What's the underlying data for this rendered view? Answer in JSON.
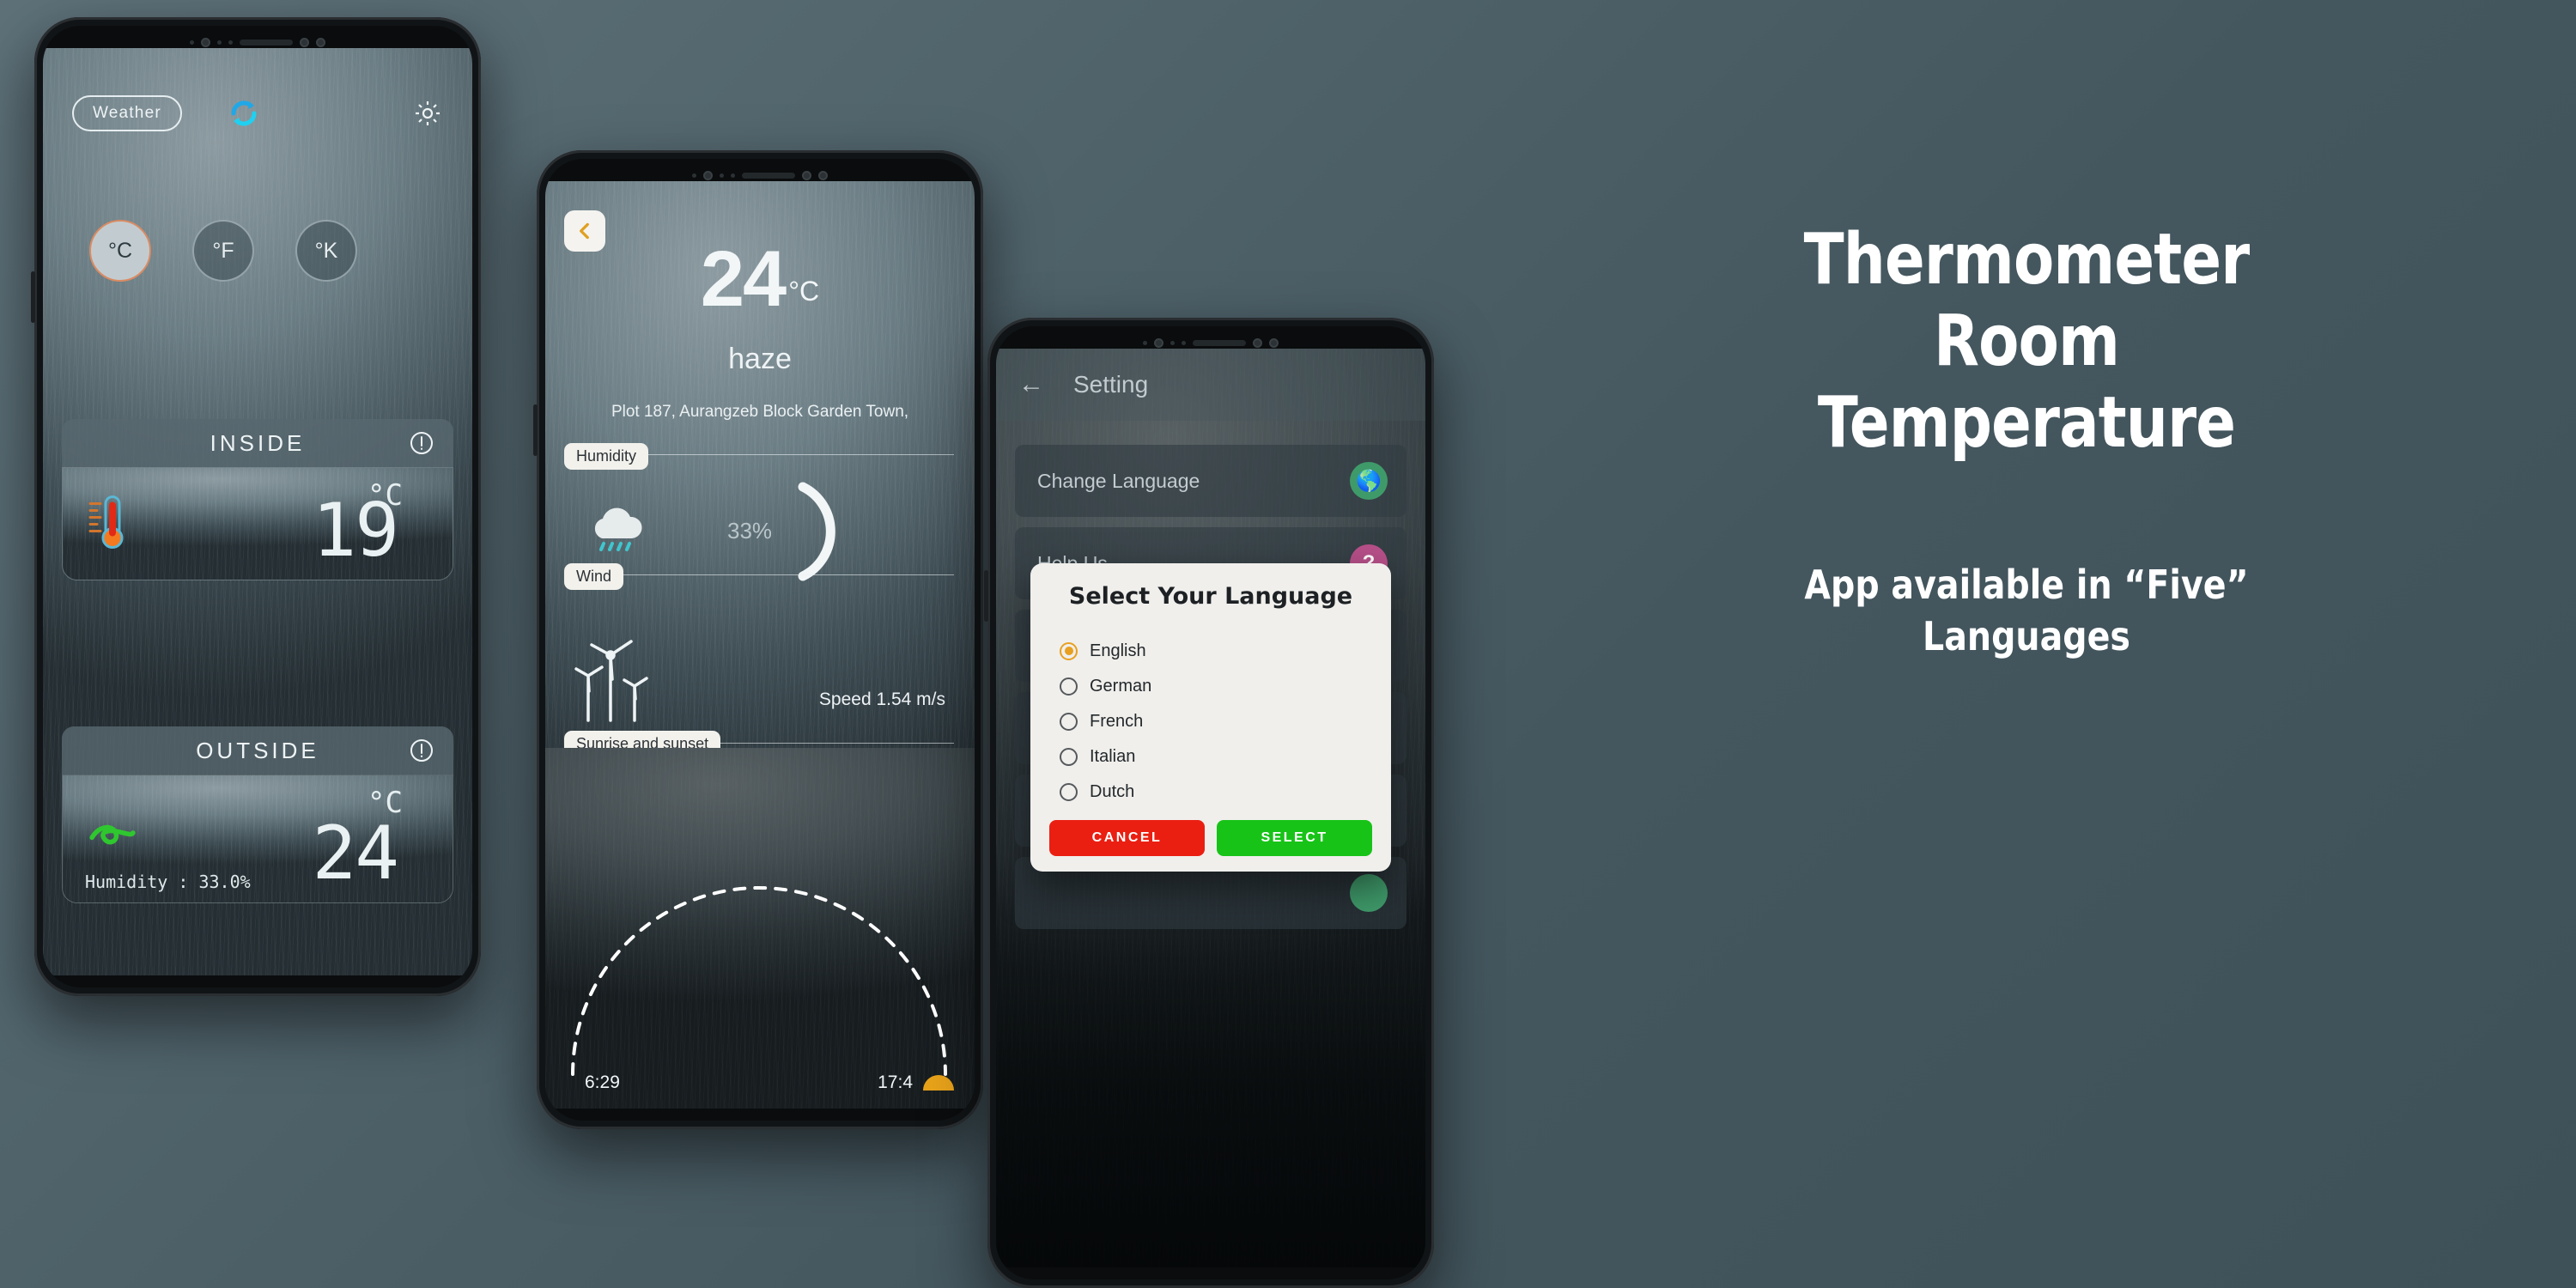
{
  "marketing": {
    "headline_line1": "Thermometer",
    "headline_line2": "Room",
    "headline_line3": "Temperature",
    "sub_line1": "App available in “Five”",
    "sub_line2": "Languages"
  },
  "phone_home": {
    "weather_chip": "Weather",
    "refresh_icon": "refresh-icon",
    "settings_icon": "gear-icon",
    "units": [
      {
        "label": "°C",
        "active": true
      },
      {
        "label": "°F",
        "active": false
      },
      {
        "label": "°K",
        "active": false
      }
    ],
    "inside": {
      "band_label": "INSIDE",
      "info_icon": "info-icon",
      "unit": "°C",
      "value": "19",
      "icon": "thermometer-icon"
    },
    "outside": {
      "band_label": "OUTSIDE",
      "info_icon": "info-icon",
      "unit": "°C",
      "value": "24",
      "icon": "wind-icon",
      "humidity": "Humidity : 33.0%"
    }
  },
  "phone_detail": {
    "back_icon": "chevron-left-icon",
    "temperature": "24",
    "temperature_unit": "°C",
    "condition": "haze",
    "address": "Plot 187, Aurangzeb Block Garden Town,",
    "humidity_tag": "Humidity",
    "humidity_value": "33%",
    "humidity_icon": "rain-cloud-icon",
    "wind_tag": "Wind",
    "wind_icon": "wind-turbine-icon",
    "wind_speed": "Speed 1.54 m/s",
    "sun_tag": "Sunrise and sunset",
    "sunrise": "6:29",
    "sunset": "17:4",
    "sun_icon": "sun-icon"
  },
  "phone_settings": {
    "back_icon": "arrow-left-icon",
    "title": "Setting",
    "rows": [
      {
        "label": "Change Language",
        "icon": "globe-icon",
        "color": "#3f9a6a"
      },
      {
        "label": "Help Us",
        "icon": "question-icon",
        "color": "#b8508a"
      },
      {
        "label": "",
        "icon": "dot-icon",
        "color": "#d93a2b"
      },
      {
        "label": "",
        "icon": "dot-icon",
        "color": "#3f9a6a"
      },
      {
        "label": "",
        "icon": "dot-icon",
        "color": "#d99a20"
      },
      {
        "label": "",
        "icon": "dot-icon",
        "color": "#3f9a6a"
      }
    ],
    "dialog": {
      "title": "Select Your Language",
      "options": [
        {
          "label": "English",
          "selected": true
        },
        {
          "label": "German",
          "selected": false
        },
        {
          "label": "French",
          "selected": false
        },
        {
          "label": "Italian",
          "selected": false
        },
        {
          "label": "Dutch",
          "selected": false
        }
      ],
      "cancel_label": "CANCEL",
      "select_label": "SELECT",
      "cancel_color": "#ea1f12",
      "select_color": "#18c318",
      "accent_color": "#e8a020"
    }
  }
}
